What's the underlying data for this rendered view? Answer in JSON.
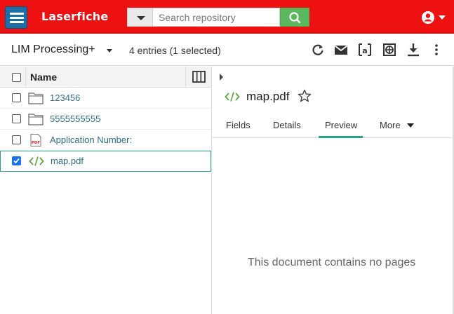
{
  "app": {
    "brand": "Laserfiche",
    "search": {
      "placeholder": "Search repository"
    },
    "accent_color": "#ee1111"
  },
  "toolbar": {
    "repository_name": "LIM Processing+",
    "entries_status": "4 entries (1 selected)",
    "icons": [
      "refresh-icon",
      "email-icon",
      "text-recognition-icon",
      "export-icon",
      "download-icon",
      "more-vert-icon"
    ]
  },
  "list": {
    "header": {
      "name": "Name"
    },
    "rows": [
      {
        "label": "123456",
        "icon": "folder-icon",
        "checked": false
      },
      {
        "label": "5555555555",
        "icon": "folder-icon",
        "checked": false
      },
      {
        "label": "Application Number:",
        "icon": "pdf-icon",
        "checked": false
      },
      {
        "label": "map.pdf",
        "icon": "code-icon",
        "checked": true
      }
    ]
  },
  "details": {
    "title": "map.pdf",
    "tabs": [
      "Fields",
      "Details",
      "Preview",
      "More"
    ],
    "active_tab": "Preview",
    "empty_message": "This document contains no pages"
  }
}
